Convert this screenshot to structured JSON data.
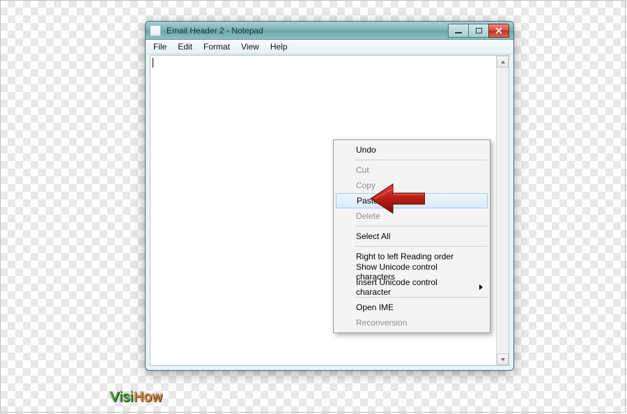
{
  "window": {
    "title": "Email Header 2 - Notepad"
  },
  "menubar": {
    "items": [
      "File",
      "Edit",
      "Format",
      "View",
      "Help"
    ]
  },
  "context_menu": {
    "items": [
      {
        "label": "Undo",
        "enabled": true
      },
      {
        "sep": true
      },
      {
        "label": "Cut",
        "enabled": false
      },
      {
        "label": "Copy",
        "enabled": false
      },
      {
        "label": "Paste",
        "enabled": true,
        "hover": true
      },
      {
        "label": "Delete",
        "enabled": false
      },
      {
        "sep": true
      },
      {
        "label": "Select All",
        "enabled": true
      },
      {
        "sep": true
      },
      {
        "label": "Right to left Reading order",
        "enabled": true
      },
      {
        "label": "Show Unicode control characters",
        "enabled": true
      },
      {
        "label": "Insert Unicode control character",
        "enabled": true,
        "submenu": true
      },
      {
        "sep": true
      },
      {
        "label": "Open IME",
        "enabled": true
      },
      {
        "label": "Reconversion",
        "enabled": false
      }
    ]
  },
  "watermark": {
    "part1": "Visi",
    "part2": "How"
  }
}
